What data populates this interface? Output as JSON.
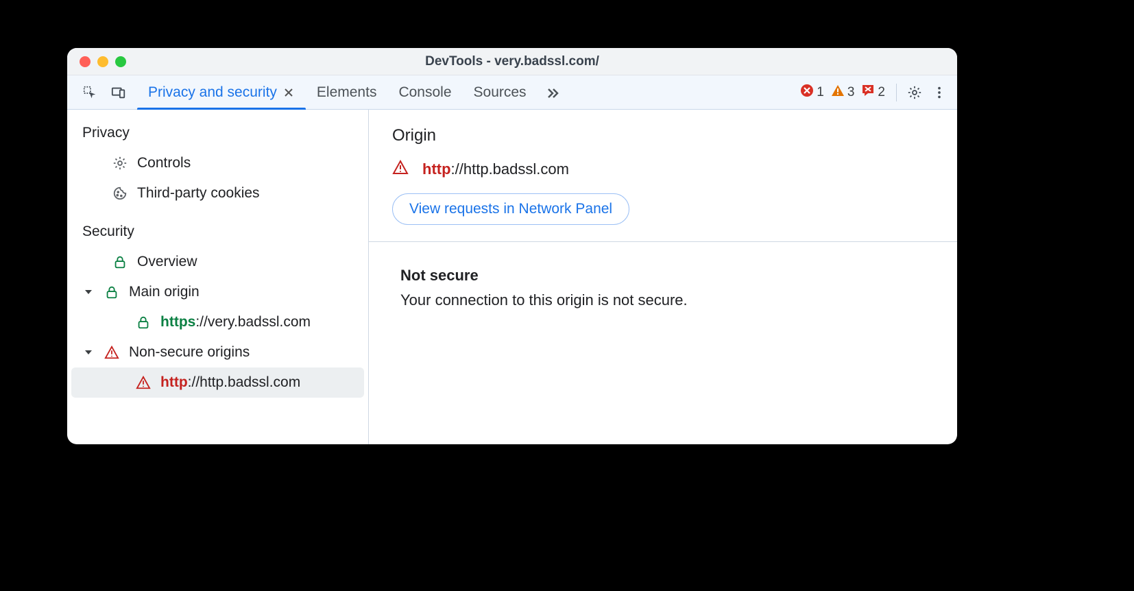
{
  "window": {
    "title": "DevTools - very.badssl.com/"
  },
  "toolbar": {
    "tabs": [
      {
        "label": "Privacy and security",
        "active": true,
        "closable": true
      },
      {
        "label": "Elements"
      },
      {
        "label": "Console"
      },
      {
        "label": "Sources"
      }
    ],
    "counters": {
      "errors": "1",
      "warnings": "3",
      "messages": "2"
    }
  },
  "sidebar": {
    "privacy": {
      "title": "Privacy",
      "items": [
        {
          "icon": "gear",
          "label": "Controls"
        },
        {
          "icon": "cookie",
          "label": "Third-party cookies"
        }
      ]
    },
    "security": {
      "title": "Security",
      "overview": {
        "icon": "lock-green",
        "label": "Overview"
      },
      "main_origin": {
        "label": "Main origin",
        "icon": "lock-green",
        "children": [
          {
            "icon": "lock-green",
            "scheme": "https",
            "scheme_text": "https",
            "rest": "://very.badssl.com"
          }
        ]
      },
      "non_secure": {
        "label": "Non-secure origins",
        "icon": "warn-red",
        "children": [
          {
            "icon": "warn-red",
            "scheme": "http",
            "scheme_text": "http",
            "rest": "://http.badssl.com",
            "selected": true
          }
        ]
      }
    }
  },
  "main": {
    "origin": {
      "title": "Origin",
      "scheme_text": "http",
      "rest": "://http.badssl.com",
      "button": "View requests in Network Panel"
    },
    "status": {
      "title": "Not secure",
      "desc": "Your connection to this origin is not secure."
    }
  }
}
